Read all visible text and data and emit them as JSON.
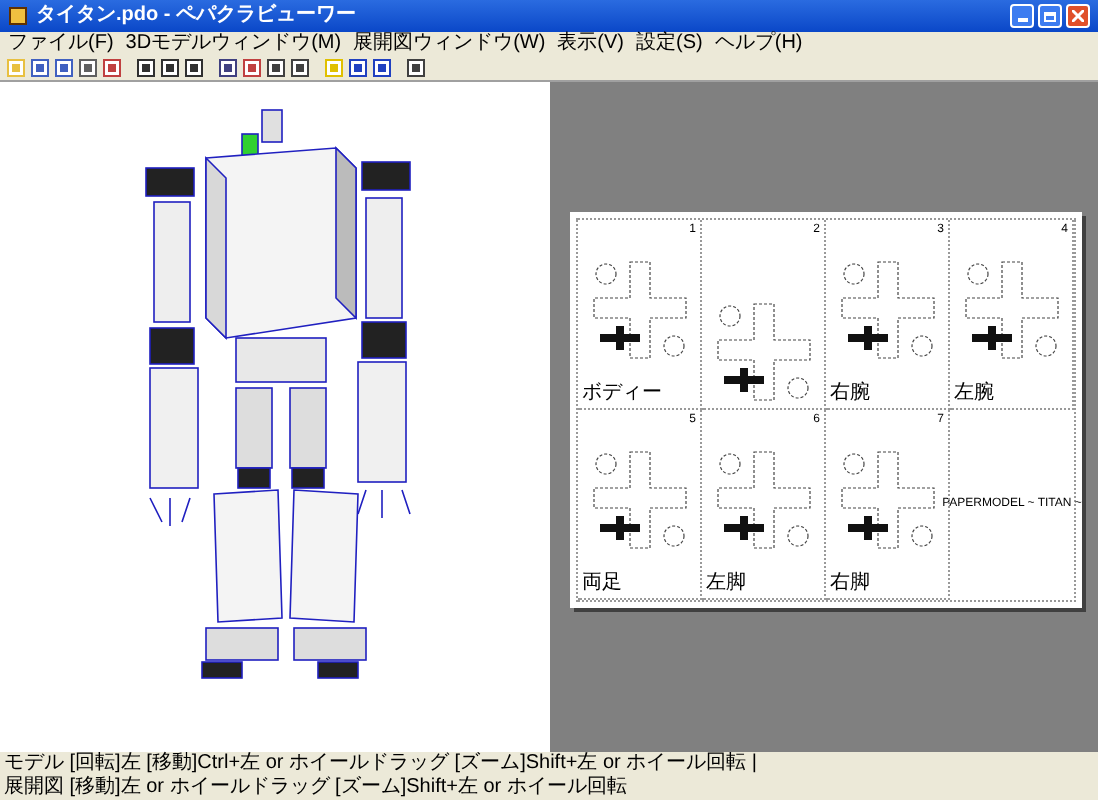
{
  "window": {
    "title": "タイタン.pdo - ペパクラビューワー"
  },
  "menu": [
    {
      "label": "ファイル(F)"
    },
    {
      "label": "3Dモデルウィンドウ(M)"
    },
    {
      "label": "展開図ウィンドウ(W)"
    },
    {
      "label": "表示(V)"
    },
    {
      "label": "設定(S)"
    },
    {
      "label": "ヘルプ(H)"
    }
  ],
  "sheet": {
    "panels": [
      {
        "number": "1",
        "label": "ボディー"
      },
      {
        "number": "2"
      },
      {
        "number": "3",
        "label": "右腕"
      },
      {
        "number": "4",
        "label": "左腕"
      },
      {
        "number": "5",
        "label": "両足"
      },
      {
        "number": "6",
        "label": "左脚"
      },
      {
        "number": "7",
        "label": "右脚"
      }
    ],
    "info_title": "PAPERMODEL ~ TITAN ~"
  },
  "status_bar": [
    "モデル [回転]左 [移動]Ctrl+左 or ホイールドラッグ [ズーム]Shift+左 or ホイール回転 |",
    "展開図 [移動]左 or ホイールドラッグ [ズーム]Shift+左 or ホイール回転"
  ]
}
